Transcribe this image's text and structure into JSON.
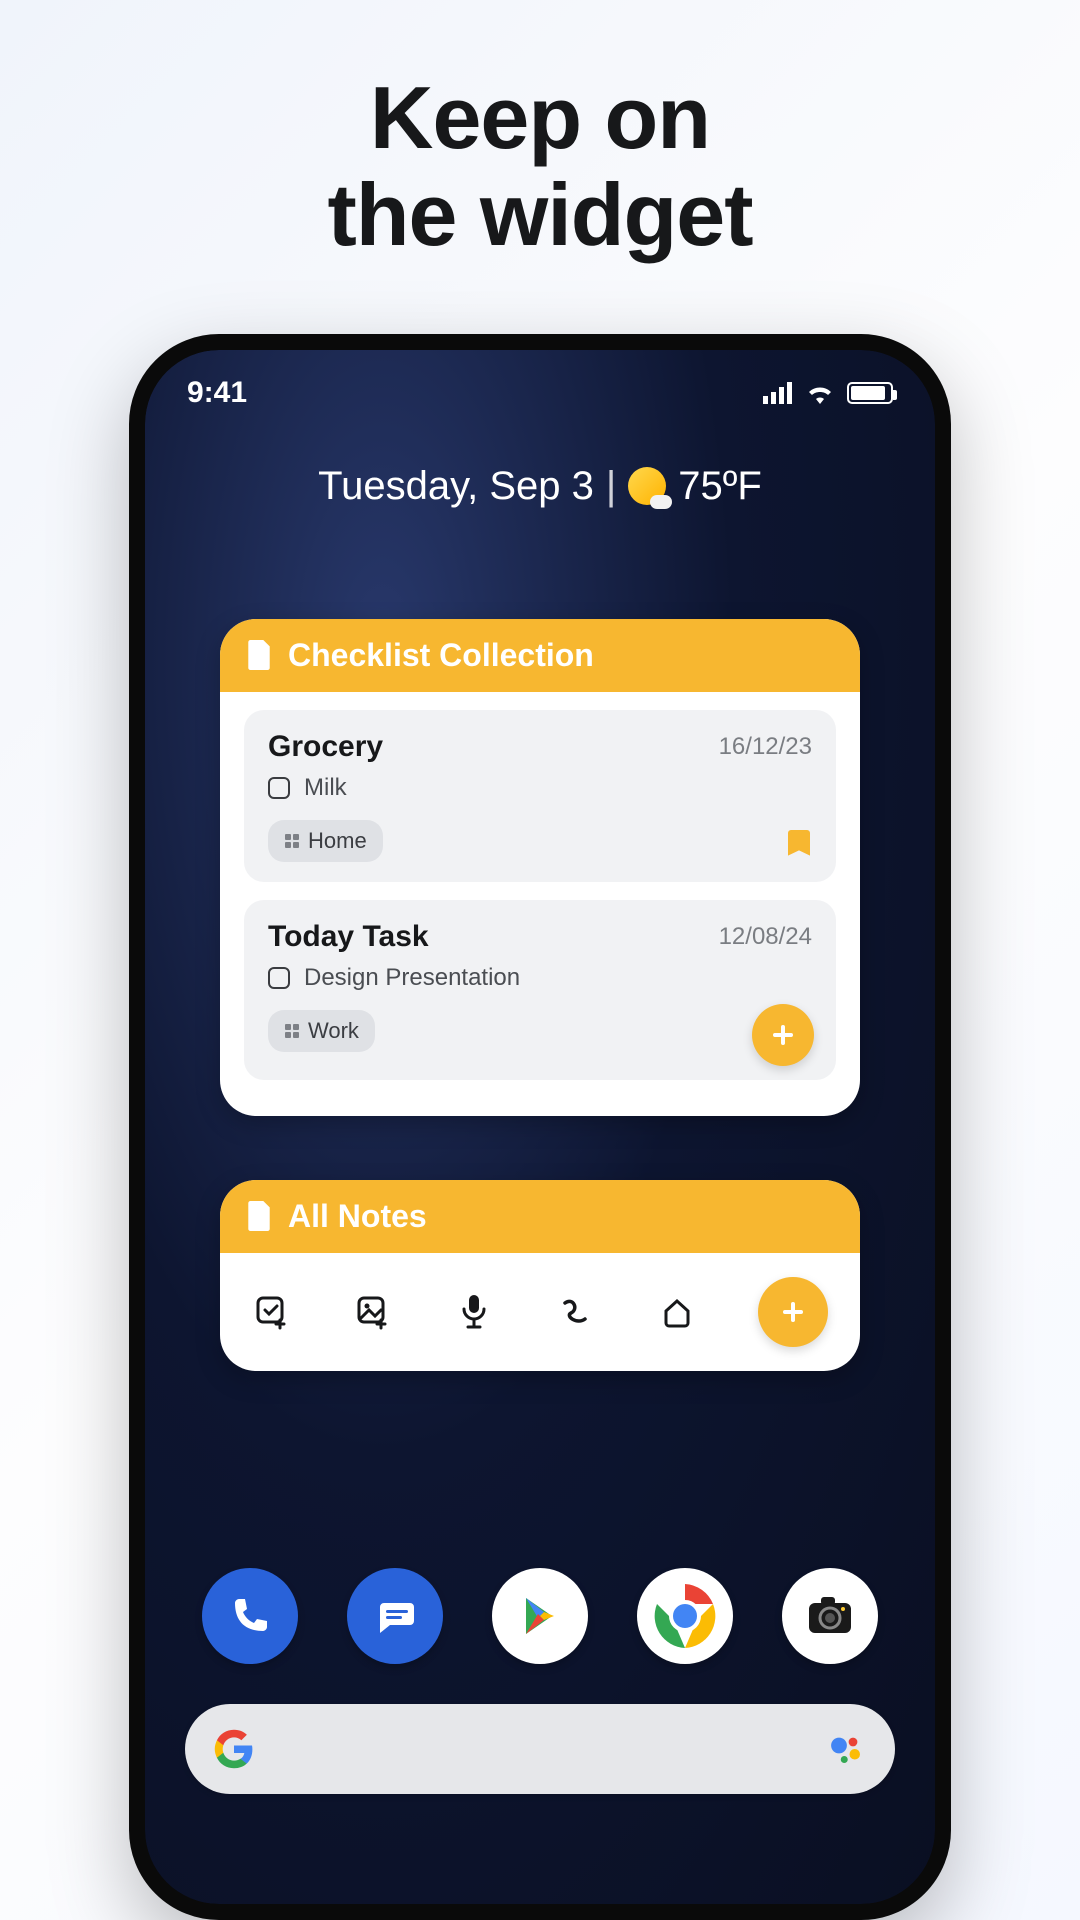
{
  "headline": {
    "line1": "Keep on",
    "line2": "the widget"
  },
  "status": {
    "time": "9:41"
  },
  "datebar": {
    "text": "Tuesday, Sep 3",
    "temp": "75ºF"
  },
  "widget_checklist": {
    "title": "Checklist Collection",
    "notes": [
      {
        "title": "Grocery",
        "date": "16/12/23",
        "item": "Milk",
        "tag": "Home",
        "has_bookmark": true
      },
      {
        "title": "Today Task",
        "date": "12/08/24",
        "item": "Design Presentation",
        "tag": "Work",
        "has_add": true
      }
    ]
  },
  "widget_allnotes": {
    "title": "All Notes"
  },
  "dock_apps": [
    "Phone",
    "Messages",
    "Play Store",
    "Chrome",
    "Camera"
  ]
}
